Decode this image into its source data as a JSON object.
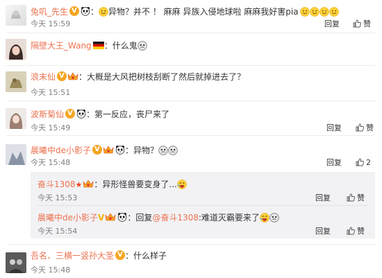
{
  "comments": [
    {
      "user": "兔叽_先生",
      "text_a": "异物？并不  ！ 麻麻 异族入侵地球啦 麻麻我好害pia",
      "time": "今天 15:59",
      "reply": "回复",
      "likes": "赞"
    },
    {
      "user": "隔壁大王_Wang",
      "text_a": "：什么鬼",
      "time": "今天 15:59",
      "reply": "回复",
      "likes": "赞"
    },
    {
      "user": "浪末仙",
      "text_a": "：大概是大风把树枝刮断了然后就掉进去了？",
      "time": "今天 15:51",
      "reply": "回复",
      "likes": "赞"
    },
    {
      "user": "波斯菊仙",
      "text_a": "：第一反应，丧尸来了",
      "time": "今天 15:49",
      "reply": "回复",
      "likes": "赞"
    },
    {
      "user": "晨曦中de小影子",
      "text_a": "：异物？",
      "time": "今天 15:48",
      "reply": "回复",
      "likes": "2"
    },
    {
      "user": "吾名、三横一竖孙大圣",
      "text_a": "：什么样子",
      "time": "今天 15:48",
      "reply": "回复",
      "likes": "赞"
    }
  ],
  "replies": [
    {
      "user": "奋斗1308",
      "text_a": "：异形怪兽要变身了...",
      "time": "今天 15:53",
      "reply": "回复",
      "likes": "赞"
    },
    {
      "user": "晨曦中de小影子",
      "text_a": "：回复",
      "mention": "@奋斗1308",
      "text_b": ":难道灭霸要来了",
      "time": "今天 15:54",
      "reply": "回复",
      "likes": "赞"
    }
  ],
  "colors": {
    "username": "#eb7350",
    "meta": "#808080",
    "reply_bg": "#f2f2f5",
    "divider": "#ececec"
  }
}
